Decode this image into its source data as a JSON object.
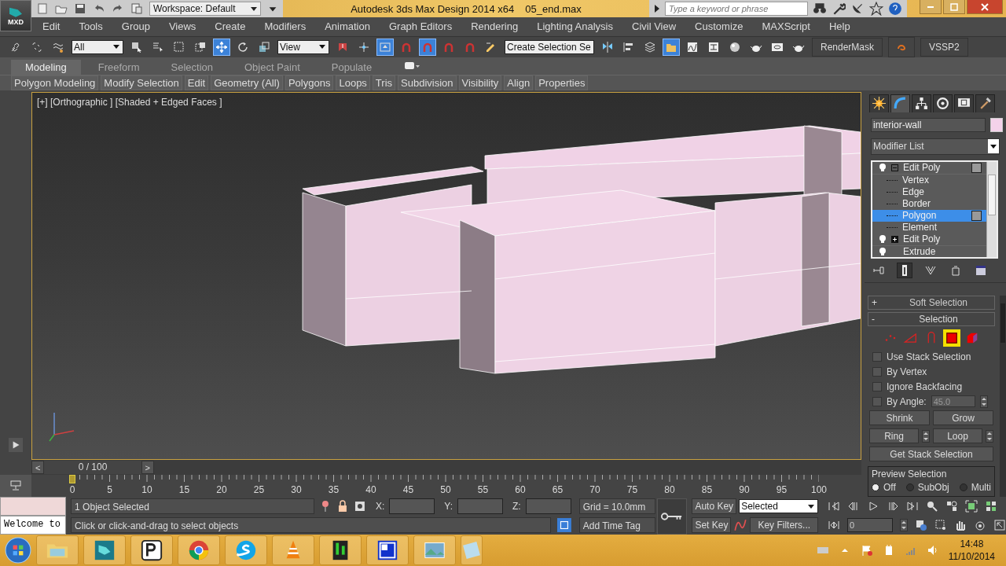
{
  "title_bar": {
    "app_badge": "MXD",
    "workspace": "Workspace: Default",
    "title": "Autodesk 3ds Max Design 2014 x64",
    "file": "05_end.max",
    "search": {
      "placeholder": "Type a keyword or phrase"
    }
  },
  "menu": [
    "Edit",
    "Tools",
    "Group",
    "Views",
    "Create",
    "Modifiers",
    "Animation",
    "Graph Editors",
    "Rendering",
    "Lighting Analysis",
    "Civil View",
    "Customize",
    "MAXScript",
    "Help"
  ],
  "main_toolbar": {
    "selection_filter": "All",
    "reference_coordinate": "View",
    "named_selection": "Create Selection Se",
    "extra_buttons": [
      "RenderMask",
      "VSSP2"
    ],
    "tools": [
      {
        "selected": false
      },
      {
        "selected": false
      },
      {
        "selected": false
      },
      {
        "selected": false
      },
      {
        "selected": false
      },
      {
        "selected": false
      },
      {
        "selected": false
      },
      {
        "selected": true
      },
      {
        "selected": false
      },
      {
        "selected": false
      },
      {
        "selected": false
      },
      {
        "selected": false
      },
      {
        "selected": true
      },
      {
        "selected": false
      },
      {
        "selected": true
      },
      {
        "selected": false
      },
      {
        "selected": false
      },
      {
        "selected": false
      },
      {
        "selected": false
      },
      {
        "selected": false
      },
      {
        "selected": false
      },
      {
        "selected": true
      },
      {
        "selected": false
      },
      {
        "selected": false
      },
      {
        "selected": false
      },
      {
        "selected": false
      },
      {
        "selected": false
      },
      {
        "selected": false
      }
    ]
  },
  "ribbon": {
    "tabs": [
      {
        "label": "Modeling",
        "selected": true
      },
      {
        "label": "Freeform",
        "selected": false
      },
      {
        "label": "Selection",
        "selected": false
      },
      {
        "label": "Object Paint",
        "selected": false
      },
      {
        "label": "Populate",
        "selected": false
      }
    ],
    "panels": [
      "Polygon Modeling",
      "Modify Selection",
      "Edit",
      "Geometry (All)",
      "Polygons",
      "Loops",
      "Tris",
      "Subdivision",
      "Visibility",
      "Align",
      "Properties"
    ]
  },
  "viewport": {
    "label": "[+] [Orthographic ] [Shaded + Edged Faces ]",
    "active": true
  },
  "command_panel": {
    "tabs": [
      {
        "selected": false
      },
      {
        "selected": true
      },
      {
        "selected": false
      },
      {
        "selected": false
      },
      {
        "selected": false
      },
      {
        "selected": false
      }
    ],
    "object_name": "interior-wall",
    "modifier_list": "Modifier List",
    "stack": [
      {
        "label": "Edit Poly",
        "expanded": true,
        "children": [
          {
            "label": "Vertex",
            "selected": false
          },
          {
            "label": "Edge",
            "selected": false
          },
          {
            "label": "Border",
            "selected": false
          },
          {
            "label": "Polygon",
            "selected": true
          },
          {
            "label": "Element",
            "selected": false
          }
        ]
      },
      {
        "label": "Edit Poly",
        "expanded": false
      },
      {
        "label": "Extrude"
      }
    ],
    "rollouts": [
      {
        "label": "Soft Selection",
        "toggle": "+",
        "expanded": false
      },
      {
        "label": "Selection",
        "toggle": "-",
        "expanded": true
      }
    ],
    "subobject_levels": [
      {
        "selected": false
      },
      {
        "selected": false
      },
      {
        "selected": false
      },
      {
        "selected": true
      },
      {
        "selected": false
      }
    ],
    "options": [
      {
        "label": "Use Stack Selection",
        "checked": false
      },
      {
        "label": "By Vertex",
        "checked": false
      },
      {
        "label": "Ignore Backfacing",
        "checked": false
      },
      {
        "label": "By Angle:",
        "checked": false
      }
    ],
    "angle_value": "45.0",
    "buttons": [
      "Shrink",
      "Grow",
      "Ring",
      "Loop",
      "Get Stack Selection"
    ],
    "preview": {
      "title": "Preview Selection",
      "options": [
        {
          "label": "Off",
          "selected": true
        },
        {
          "label": "SubObj",
          "selected": false
        },
        {
          "label": "Multi",
          "selected": false
        }
      ]
    }
  },
  "timeline": {
    "level": 0,
    "prev": "<",
    "frame": "0 / 100",
    "next": ">",
    "ticks": [
      "0",
      "5",
      "10",
      "15",
      "20",
      "25",
      "30",
      "35",
      "40",
      "45",
      "50",
      "55",
      "60",
      "65",
      "70",
      "75",
      "80",
      "85",
      "90",
      "95",
      "100"
    ]
  },
  "status": {
    "listener": "Welcome to",
    "selection": "1 Object Selected",
    "prompt": "Click or click-and-drag to select objects",
    "x_label": "X:",
    "y_label": "Y:",
    "z_label": "Z:",
    "grid": "Grid = 10.0mm",
    "time_tag": "Add Time Tag",
    "auto_key": "Auto Key",
    "set_key": "Set Key",
    "key_mode": "Selected",
    "key_filters": "Key Filters...",
    "current_frame": "0"
  },
  "taskbar": {
    "time": "14:48",
    "date": "11/10/2014"
  }
}
